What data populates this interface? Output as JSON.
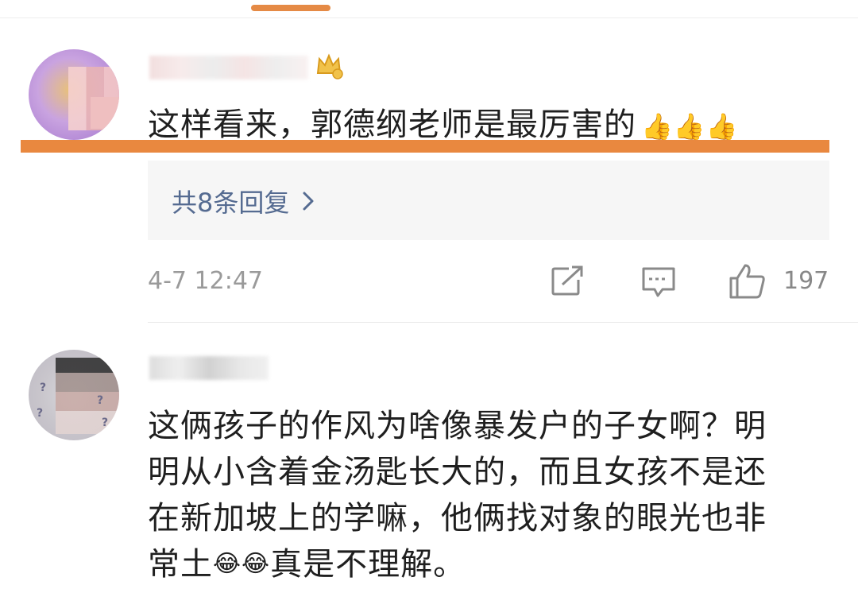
{
  "comments": [
    {
      "text": "这样看来，郭德纲老师是最厉害的",
      "emoji": "👍👍👍",
      "replies_label": "共8条回复",
      "timestamp": "4-7 12:47",
      "like_count": "197",
      "accent_color": "#e9883f"
    },
    {
      "text_lines": [
        "这俩孩子的作风为啥像暴发户的子女啊？明",
        "明从小含着金汤匙长大的，而且女孩不是还",
        "在新加坡上的学嘛，他俩找对象的眼光也非"
      ],
      "last_line_start": "常土",
      "last_line_emoji": "😂😂",
      "last_line_end": "真是不理解。"
    }
  ],
  "icons": [
    "crown-icon",
    "chevron-right-icon",
    "share-icon",
    "comment-icon",
    "like-icon"
  ],
  "colors": {
    "link": "#556b91",
    "highlight": "#e9883f",
    "muted": "#9a9a9a"
  }
}
